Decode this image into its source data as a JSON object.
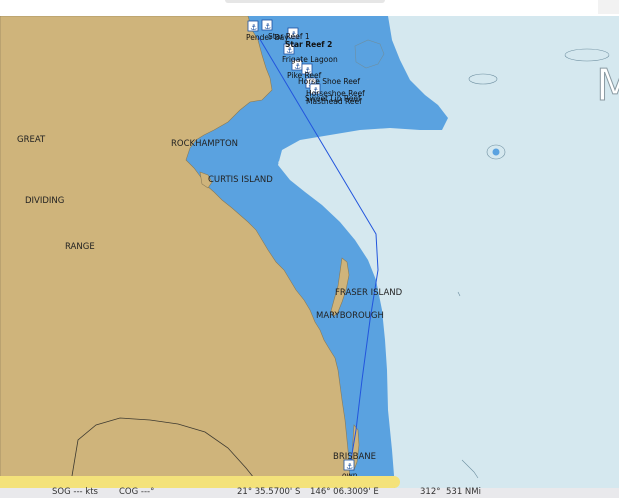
{
  "map": {
    "big_label_partial": "M",
    "region_labels": [
      {
        "id": "great",
        "text": "GREAT"
      },
      {
        "id": "dividing",
        "text": "DIVIDING"
      },
      {
        "id": "range",
        "text": "RANGE"
      }
    ],
    "place_labels": [
      {
        "id": "rockhampton",
        "text": "ROCKHAMPTON"
      },
      {
        "id": "curtis-island",
        "text": "CURTIS ISLAND"
      },
      {
        "id": "fraser-island",
        "text": "FRASER ISLAND"
      },
      {
        "id": "maryborough",
        "text": "MARYBOROUGH"
      },
      {
        "id": "brisbane",
        "text": "BRISBANE"
      }
    ],
    "waypoints": [
      {
        "id": "pender-bay",
        "label": "Pender Bay"
      },
      {
        "id": "star-reef-1",
        "label": "Star Reef 1"
      },
      {
        "id": "star-reef-2",
        "label": "Star Reef 2"
      },
      {
        "id": "frigate-lagoon",
        "label": "Frigate Lagoon"
      },
      {
        "id": "pike-reef",
        "label": "Pike Reef"
      },
      {
        "id": "horse-shoe-reef",
        "label": "Horse Shoe Reef"
      },
      {
        "id": "horseshoe-reef",
        "label": "Horseshoe Reef"
      },
      {
        "id": "sweet-lip-reef",
        "label": "Sweet Lip Reef"
      },
      {
        "id": "masthead-reef",
        "label": "Masthead Reef"
      }
    ],
    "own_ship_label": "own",
    "colors": {
      "land": "#cfb47b",
      "shallow": "#5aa2e0",
      "deep": "#d5e8ef",
      "route": "#2255dd"
    }
  },
  "status": {
    "sog": "SOG --- kts",
    "cog": "COG ---°",
    "lat": "21° 35.5700' S",
    "lon": "146° 06.3009' E",
    "brg": "312°",
    "dist": "531 NMi"
  }
}
